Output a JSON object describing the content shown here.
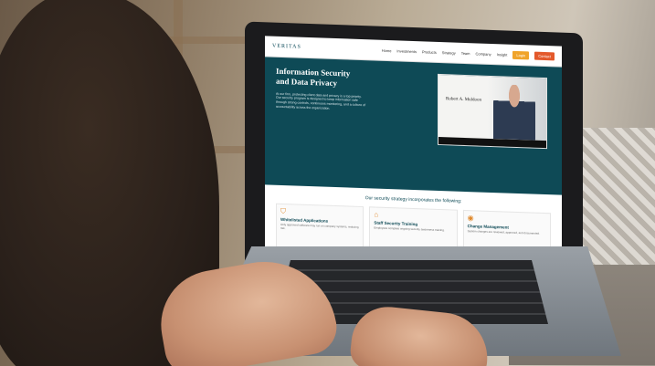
{
  "website": {
    "logo": "VERITAS",
    "nav": [
      "Home",
      "Investments",
      "Products",
      "Strategy",
      "Team",
      "Company",
      "Insight"
    ],
    "cta_primary": "Contact",
    "cta_secondary": "Login",
    "hero_title": "Information Security and Data Privacy",
    "hero_text": "At our firm, protecting client data and privacy is a top priority. Our security program is designed to keep information safe through strong controls, continuous monitoring, and a culture of accountability across the organization.",
    "video_name": "Robert A. Muldoon",
    "section_heading": "Our security strategy incorporates the following:",
    "cards": [
      {
        "icon": "shield-icon",
        "title": "Whitelisted Applications",
        "text": "Only approved software may run on company systems, reducing risk."
      },
      {
        "icon": "cap-icon",
        "title": "Staff Security Training",
        "text": "Employees complete ongoing security awareness training."
      },
      {
        "icon": "eye-icon",
        "title": "Change Management",
        "text": "System changes are reviewed, approved, and documented."
      }
    ]
  },
  "colors": {
    "brand": "#0e4a56",
    "accent": "#e3592b",
    "accent2": "#f0a42b"
  }
}
